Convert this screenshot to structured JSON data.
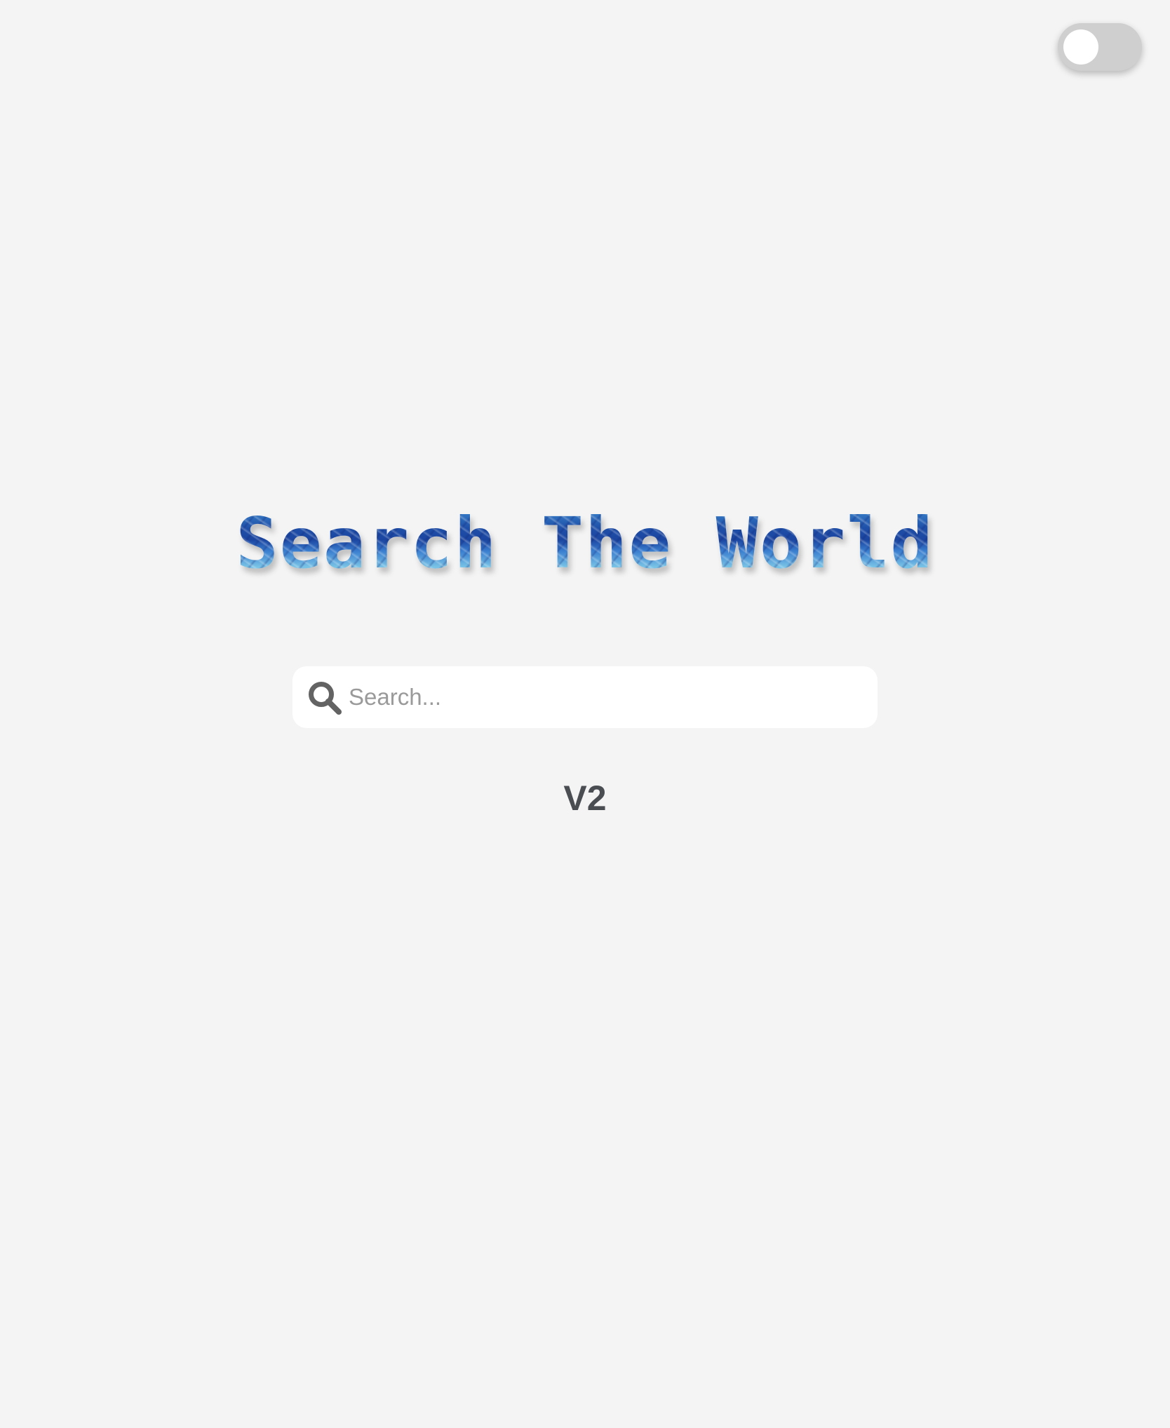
{
  "theme_toggle": {
    "state": "off",
    "track_color": "#cfcfcf",
    "knob_color": "#ffffff"
  },
  "hero": {
    "title": "Search The World"
  },
  "search": {
    "icon": "search-icon",
    "placeholder": "Search...",
    "value": ""
  },
  "footer": {
    "version": "V2"
  },
  "colors": {
    "background": "#f4f4f4",
    "title_blue": "#2a67b8",
    "title_light_blue": "#9ad6ef",
    "icon_gray": "#636363",
    "version_text": "#4a4d52"
  }
}
